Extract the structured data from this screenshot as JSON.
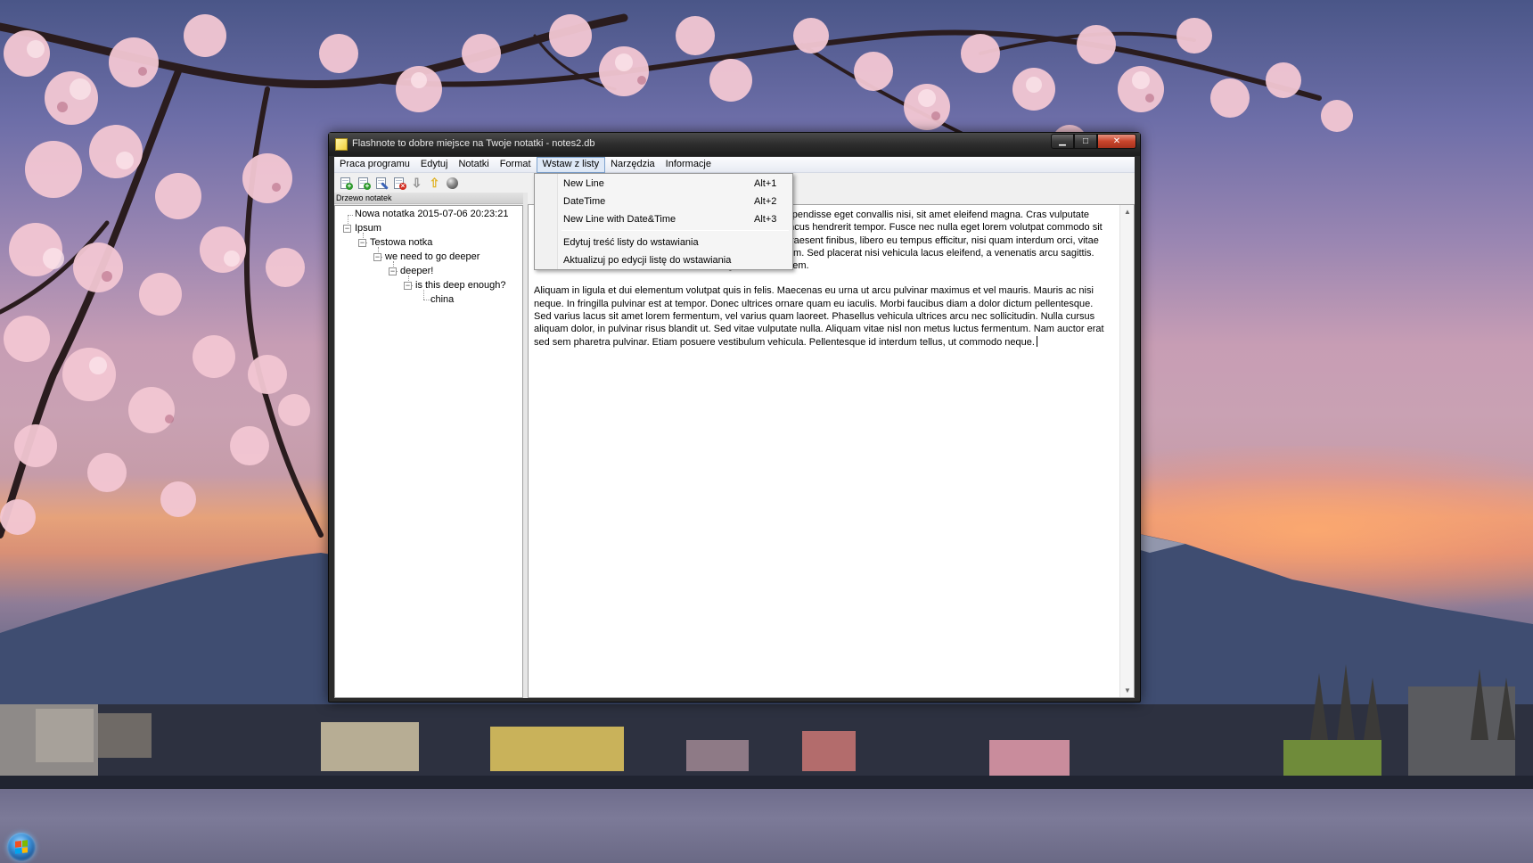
{
  "window": {
    "title": "Flashnote to dobre miejsce na Twoje notatki - notes2.db",
    "minimize": "▁",
    "maximize": "□",
    "close": "✕"
  },
  "menubar": {
    "items": [
      "Praca programu",
      "Edytuj",
      "Notatki",
      "Format",
      "Wstaw z listy",
      "Narzędzia",
      "Informacje"
    ],
    "open_item": "Wstaw z listy"
  },
  "toolbar": {
    "icons": [
      "new-note-icon",
      "add-subnote-icon",
      "edit-note-icon",
      "delete-note-icon",
      "move-down-icon",
      "move-up-icon",
      "globe-icon"
    ]
  },
  "tree": {
    "header": "Drzewo notatek",
    "nodes": [
      {
        "label": "Nowa notatka 2015-07-06 20:23:21",
        "level": 0
      },
      {
        "label": "Ipsum",
        "level": 0
      },
      {
        "label": "Testowa notka",
        "level": 1
      },
      {
        "label": "we need to go deeper",
        "level": 2
      },
      {
        "label": "deeper!",
        "level": 3
      },
      {
        "label": "is this deep enough?",
        "level": 4
      },
      {
        "label": "china",
        "level": 5
      }
    ]
  },
  "editor": {
    "paragraph1": "Lorem ipsum dolor sit amet, consectetur adipiscing elit. Suspendisse eget convallis nisi, sit amet eleifend magna. Cras vulputate blandit tortor, et fermentum ipsum tincidunt at. Quisque rhoncus hendrerit tempor. Fusce nec nulla eget lorem volutpat commodo sit amet sed magna. Donec ac elit vitae nisl placerat rutrum. Praesent finibus, libero eu tempus efficitur, nisi quam interdum orci, vitae consequat arcu massa vitae sapien. Vestibulum eu tortor sem. Sed placerat nisi vehicula lacus eleifend, a venenatis arcu sagittis. Nunc at convallis est. Etiam in dui efficitur sagittis vitae eu sem.",
    "paragraph2": "Aliquam in ligula et dui elementum volutpat quis in felis. Maecenas eu urna ut arcu pulvinar maximus et vel mauris. Mauris ac nisi neque. In fringilla pulvinar est at tempor. Donec ultrices ornare quam eu iaculis. Morbi faucibus diam a dolor dictum pellentesque. Sed varius lacus sit amet lorem fermentum, vel varius quam laoreet. Phasellus vehicula ultrices arcu nec sollicitudin. Nulla cursus aliquam dolor, in pulvinar risus blandit ut. Sed vitae vulputate nulla. Aliquam vitae nisl non metus luctus fermentum. Nam auctor erat sed sem pharetra pulvinar. Etiam posuere vestibulum vehicula. Pellentesque id interdum tellus, ut commodo neque."
  },
  "dropdown": {
    "items": [
      {
        "label": "New Line",
        "shortcut": "Alt+1"
      },
      {
        "label": "DateTime",
        "shortcut": "Alt+2"
      },
      {
        "label": "New Line with Date&Time",
        "shortcut": "Alt+3"
      },
      {
        "label": "Edytuj treść listy do wstawiania",
        "shortcut": ""
      },
      {
        "label": "Aktualizuj po edycji listę do wstawiania",
        "shortcut": ""
      }
    ]
  },
  "colors": {
    "menu_highlight": "#dfe9f7",
    "menu_highlight_border": "#7da2ce",
    "close_button": "#c9452c"
  }
}
